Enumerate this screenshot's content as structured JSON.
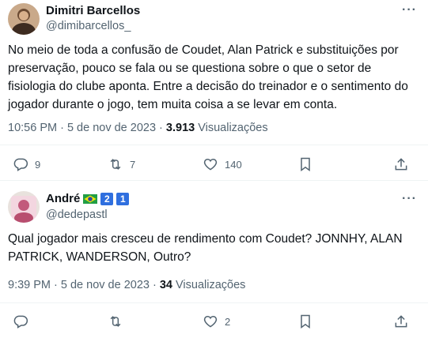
{
  "tweets": [
    {
      "name": "Dimitri Barcellos",
      "handle": "@dimibarcellos_",
      "more": "···",
      "text": "No meio de toda a confusão de Coudet, Alan Patrick e substituições por preservação, pouco se fala ou se questiona sobre o que o setor de fisiologia do clube aponta. Entre a decisão do treinador e o sentimento do jogador durante o jogo, tem muita coisa a se levar em conta.",
      "time": "10:56 PM · 5 de nov de 2023 · ",
      "views_count": "3.913",
      "views_label": " Visualizações",
      "replies": "9",
      "retweets": "7",
      "likes": "140"
    },
    {
      "name": "André",
      "badges": [
        "🇧🇷",
        "2",
        "1"
      ],
      "handle": "@dedepastl",
      "more": "···",
      "text": "Qual jogador mais cresceu de rendimento com Coudet? JONNHY, ALAN PATRICK, WANDERSON, Outro?",
      "time": "9:39 PM · 5 de nov de 2023 · ",
      "views_count": "34",
      "views_label": " Visualizações",
      "replies": "",
      "retweets": "",
      "likes": "2"
    }
  ],
  "icons": [
    "reply-icon",
    "retweet-icon",
    "like-icon",
    "bookmark-icon",
    "share-icon"
  ]
}
